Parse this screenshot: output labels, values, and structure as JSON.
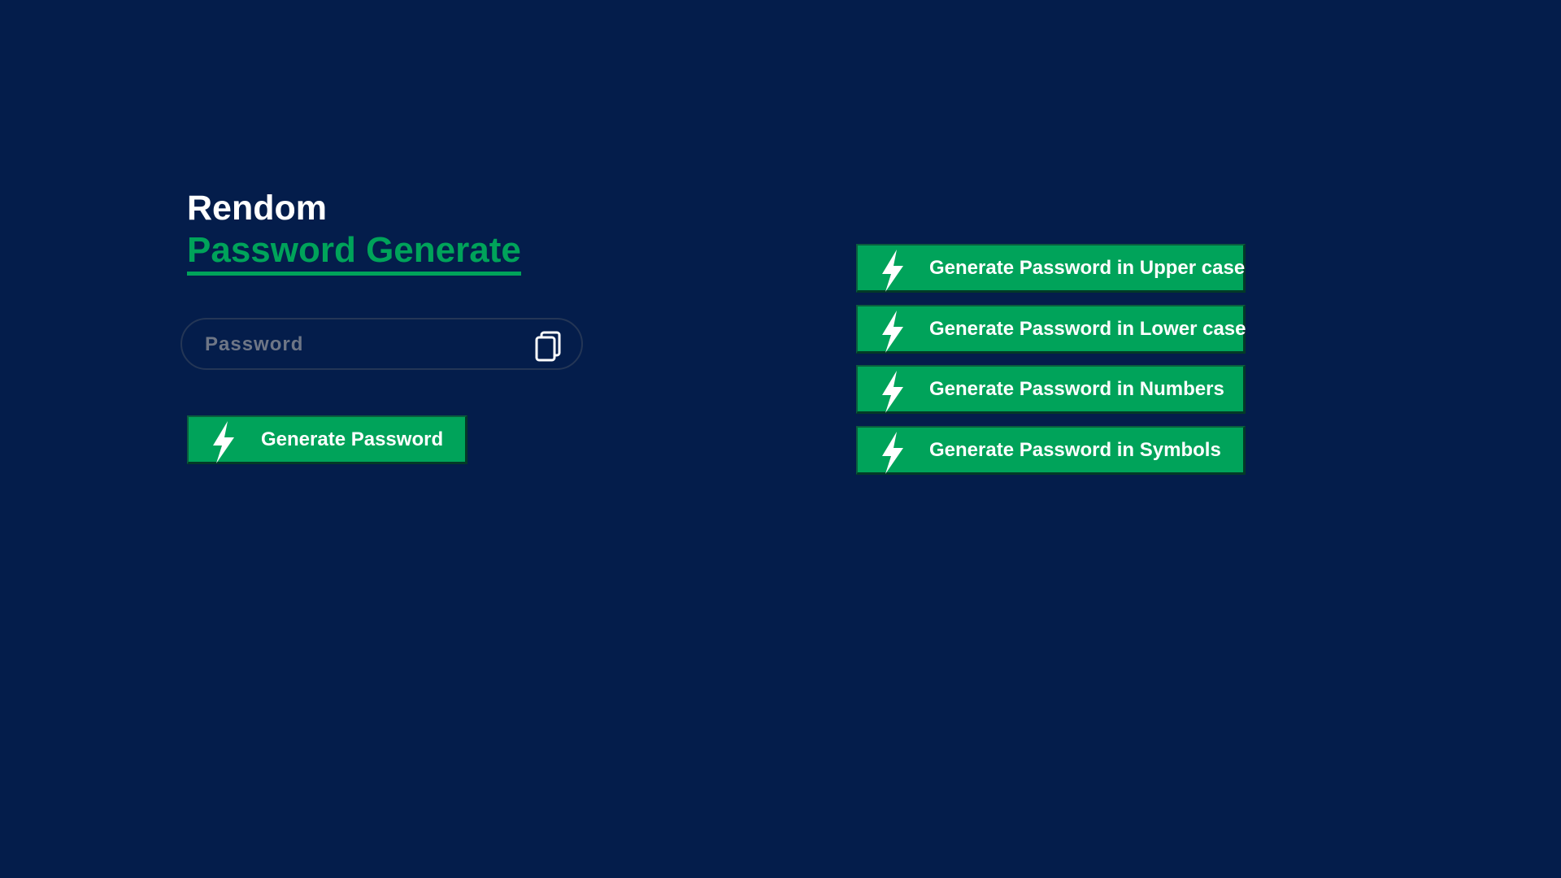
{
  "title": {
    "line1": "Rendom",
    "line2": "Password Generate"
  },
  "password_field": {
    "value": "",
    "placeholder": "Password",
    "copy_icon": "copy-icon"
  },
  "buttons": {
    "generate": "Generate Password",
    "upper": "Generate Password in Upper case",
    "lower": "Generate Password in Lower case",
    "numbers": "Generate Password in Numbers",
    "symbols": "Generate Password in Symbols"
  },
  "icons": {
    "button_icon": "lightning-bolt-icon"
  },
  "colors": {
    "background": "#041d4b",
    "accent": "#00a35a",
    "text": "#ffffff",
    "placeholder": "#6e7686"
  }
}
